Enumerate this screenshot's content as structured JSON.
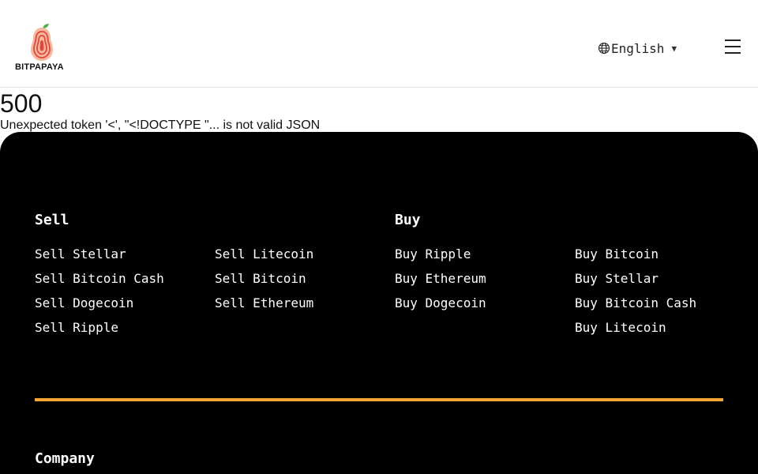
{
  "header": {
    "brand": "BITPAPAYA",
    "language": "English",
    "icons": {
      "language": "globe-icon",
      "caret": "caret-down-icon",
      "menu": "hamburger-menu-icon"
    }
  },
  "error": {
    "code": "500",
    "message": "Unexpected token '<', \"<!DOCTYPE \"... is not valid JSON"
  },
  "footer": {
    "sell": {
      "title": "Sell",
      "col1": [
        "Sell Stellar",
        "Sell Bitcoin Cash",
        "Sell Dogecoin",
        "Sell Ripple"
      ],
      "col2": [
        "Sell Litecoin",
        "Sell Bitcoin",
        "Sell Ethereum"
      ]
    },
    "buy": {
      "title": "Buy",
      "col1": [
        "Buy Ripple",
        "Buy Ethereum",
        "Buy Dogecoin"
      ],
      "col2": [
        "Buy Bitcoin",
        "Buy Stellar",
        "Buy Bitcoin Cash",
        "Buy Litecoin"
      ]
    },
    "company": {
      "title": "Company"
    }
  },
  "colors": {
    "footer_bg": "#000000",
    "accent_divider": "#f7a534",
    "logo_red": "#e2463b",
    "logo_peach": "#f6b9a0",
    "logo_leaf": "#4caf3a"
  }
}
